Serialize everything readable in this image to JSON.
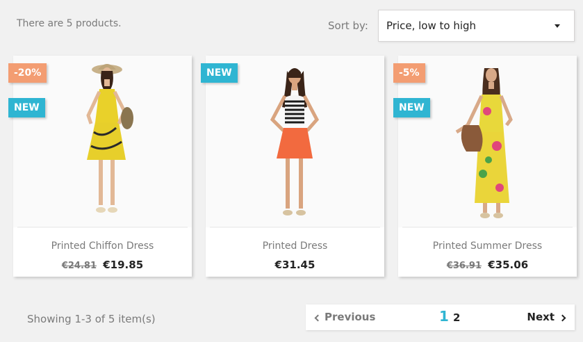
{
  "header": {
    "product_count": "There are 5 products.",
    "sort_label": "Sort by:",
    "sort_value": "Price, low to high"
  },
  "products": [
    {
      "name": "Printed Chiffon Dress",
      "old_price": "€24.81",
      "price": "€19.85",
      "flags": [
        "-20%",
        "NEW"
      ]
    },
    {
      "name": "Printed Dress",
      "old_price": "",
      "price": "€31.45",
      "flags": [
        "NEW"
      ]
    },
    {
      "name": "Printed Summer Dress",
      "old_price": "€36.91",
      "price": "€35.06",
      "flags": [
        "-5%",
        "NEW"
      ]
    }
  ],
  "footer": {
    "showing": "Showing 1-3 of 5 item(s)",
    "previous": "Previous",
    "next": "Next",
    "pages": [
      "1",
      "2"
    ],
    "current_page": "1"
  },
  "colors": {
    "accent": "#2fb5d2",
    "discount": "#f39d72",
    "background": "#f1f1f1"
  }
}
